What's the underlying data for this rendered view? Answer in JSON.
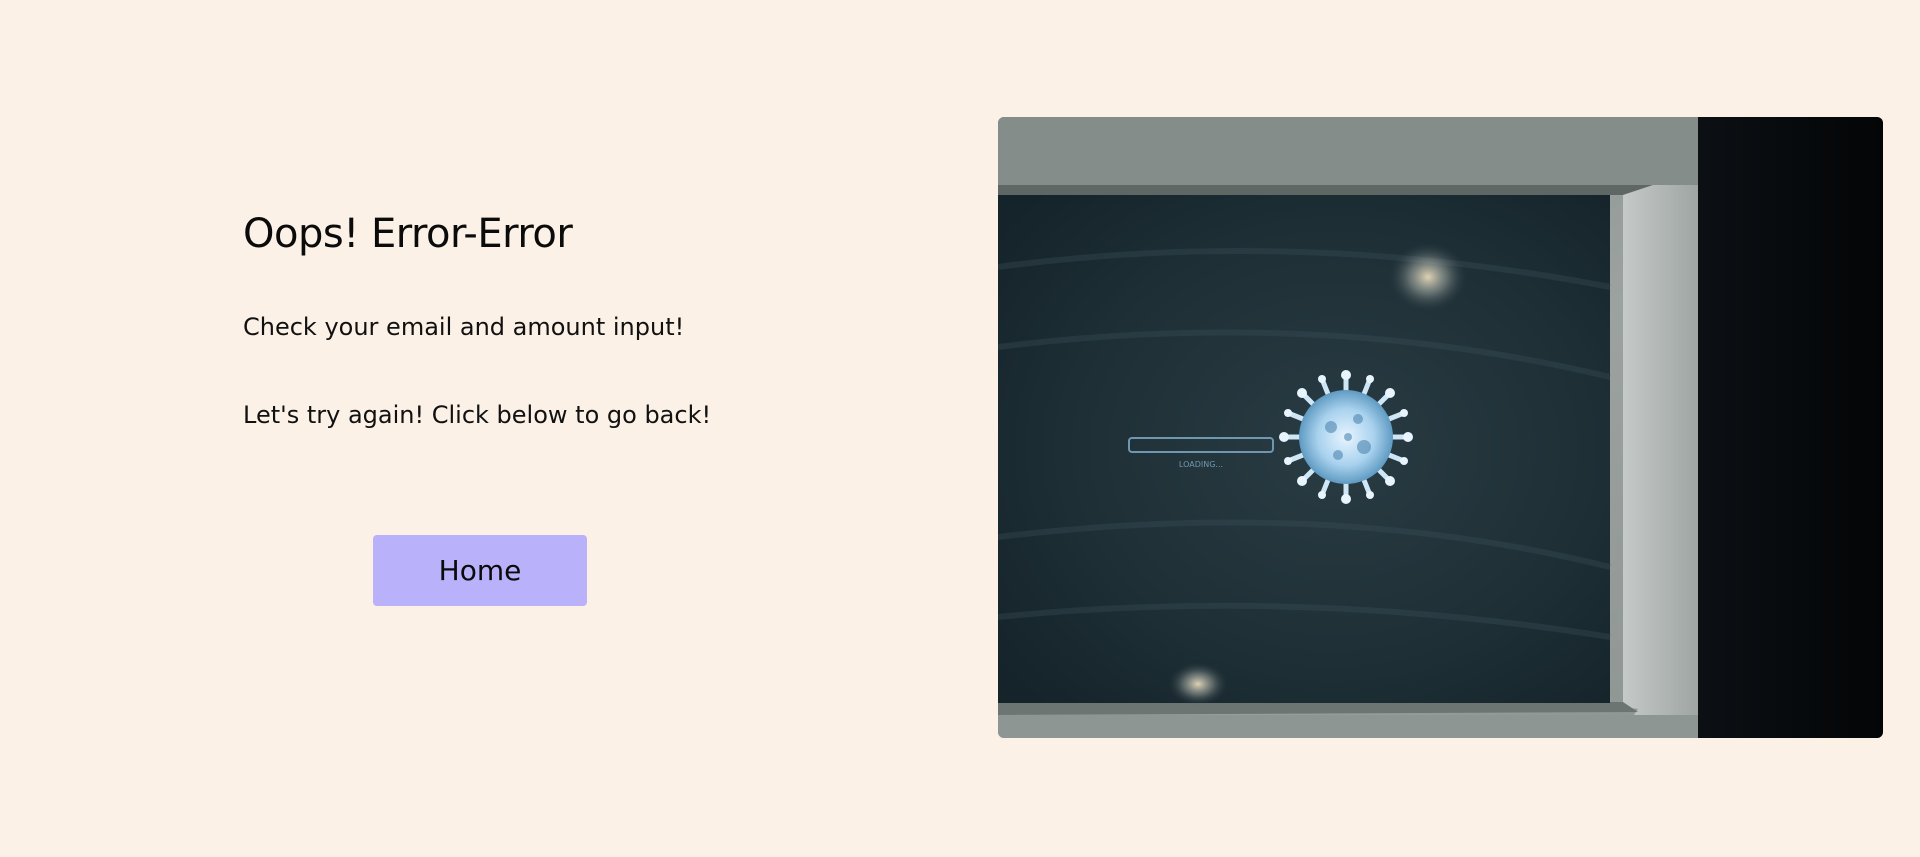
{
  "error": {
    "title": "Oops! Error-Error",
    "message_line1": "Check your email and amount input!",
    "message_line2": "Let's try again! Click below to go back!"
  },
  "actions": {
    "home_label": "Home"
  },
  "image": {
    "screen_text": "LOADING...",
    "icon": "virus-icon"
  },
  "colors": {
    "background": "#fbf1e6",
    "button": "#b9b2fb",
    "text": "#0b0b0b"
  }
}
